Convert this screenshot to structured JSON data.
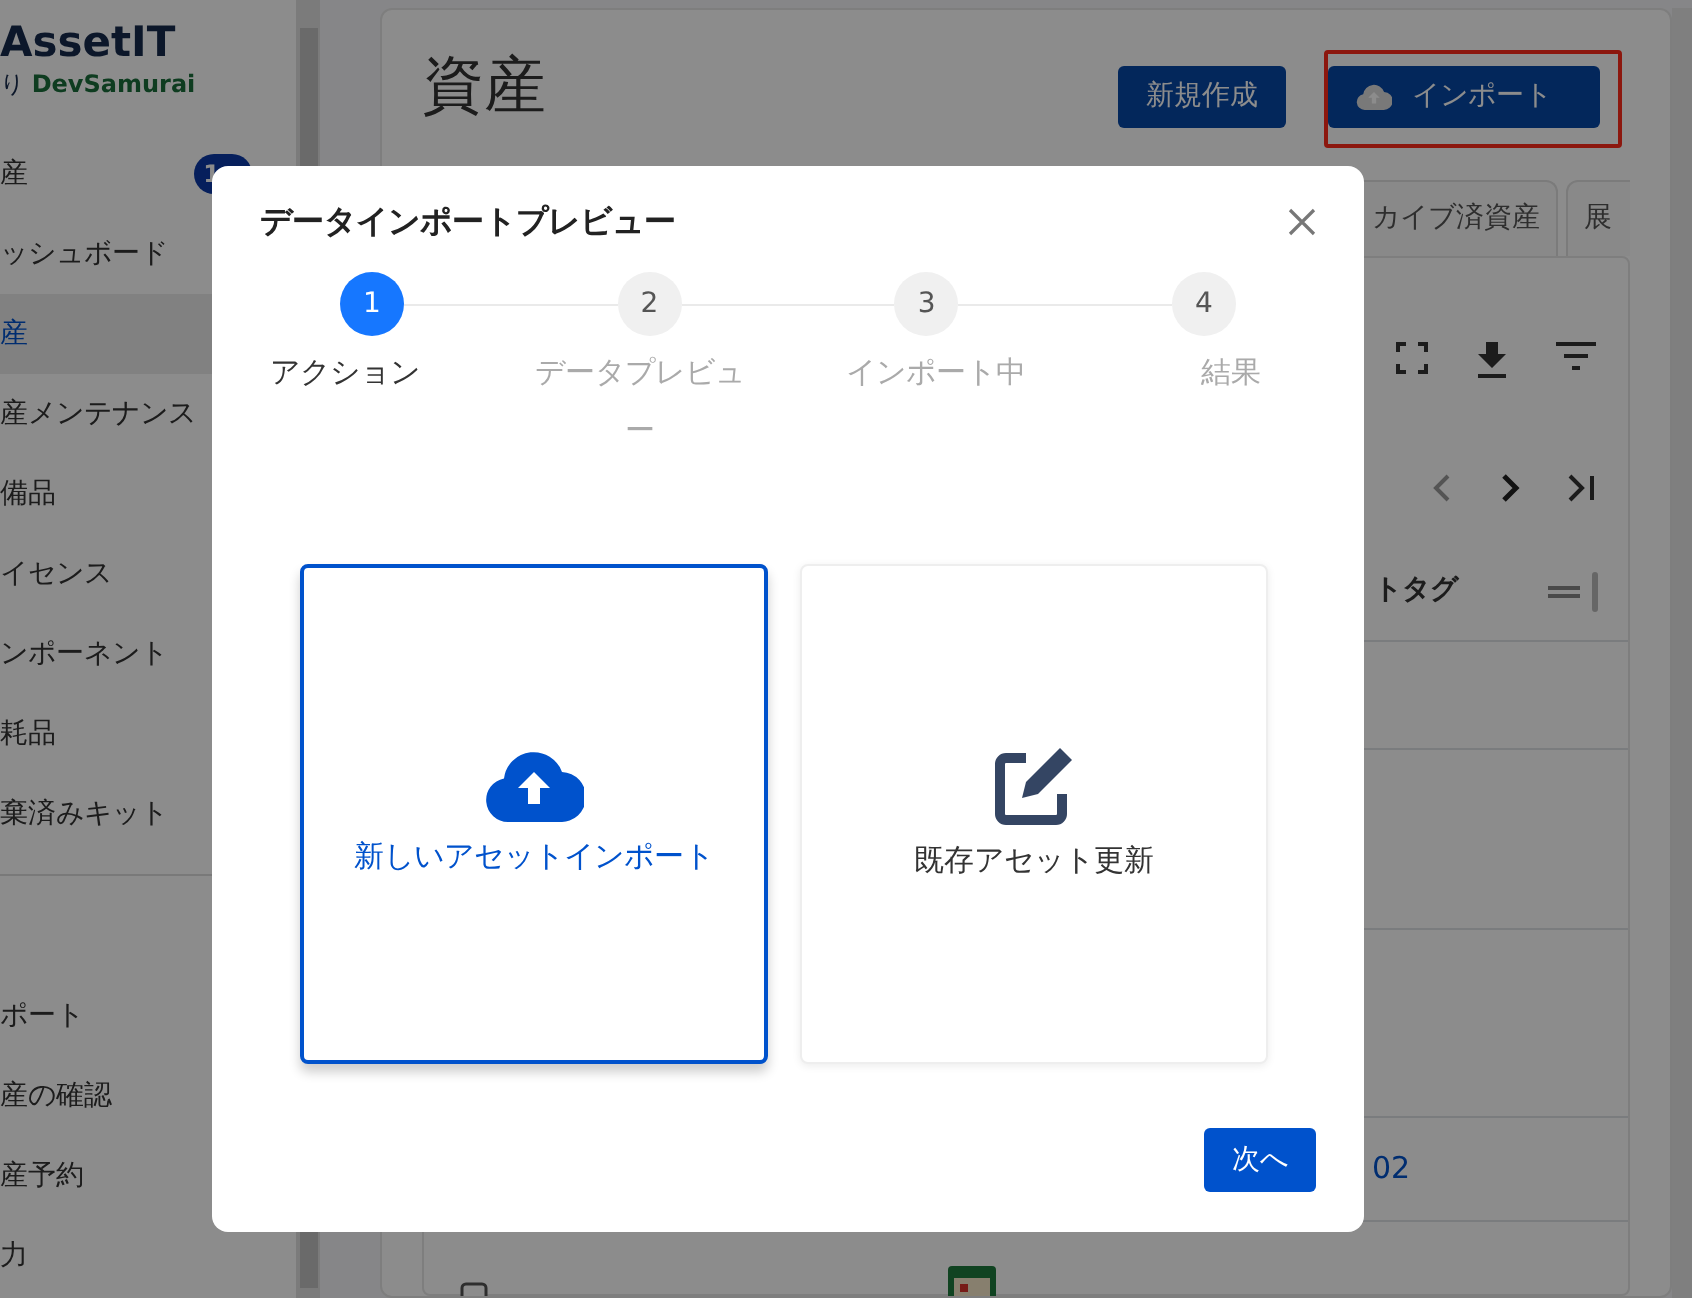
{
  "sidebar": {
    "brand": "AssetIT",
    "brand_sub": "り",
    "brand_company": "DevSamurai",
    "items": [
      {
        "label": "産",
        "badge": "1",
        "selected": false
      },
      {
        "label": "ッシュボード",
        "selected": false
      },
      {
        "label": "産",
        "selected": true
      },
      {
        "label": "産メンテナンス",
        "selected": false
      },
      {
        "label": "備品",
        "selected": false
      },
      {
        "label": "イセンス",
        "selected": false
      },
      {
        "label": "ンポーネント",
        "selected": false
      },
      {
        "label": "耗品",
        "selected": false
      },
      {
        "label": "棄済みキット",
        "selected": false
      }
    ],
    "items_2": [
      {
        "label": "ポート",
        "selected": false
      },
      {
        "label": "産の確認",
        "selected": false
      },
      {
        "label": "産予約",
        "selected": false
      },
      {
        "label": "力",
        "selected": false
      }
    ]
  },
  "page": {
    "title": "資産",
    "buttons": [
      {
        "label": "新規作成",
        "kind": "plain",
        "highlighted": false
      },
      {
        "label": "インポート",
        "kind": "upload",
        "highlighted": true
      }
    ],
    "tabs": [
      {
        "label": "カイブ済資産"
      },
      {
        "label": "展"
      }
    ],
    "column_header": "トタグ",
    "row_link": "02",
    "row_checked": false
  },
  "modal": {
    "title": "データインポートプレビュー",
    "steps": [
      {
        "number": "1",
        "label": "アクション",
        "selected": true
      },
      {
        "number": "2",
        "label": "データプレビュー",
        "selected": false
      },
      {
        "number": "3",
        "label": "インポート中",
        "selected": false
      },
      {
        "number": "4",
        "label": "結果",
        "selected": false
      }
    ],
    "options": [
      {
        "label": "新しいアセットインポート",
        "kind": "upload",
        "selected": true
      },
      {
        "label": "既存アセット更新",
        "kind": "edit",
        "selected": false
      }
    ],
    "next_button": "次へ"
  }
}
